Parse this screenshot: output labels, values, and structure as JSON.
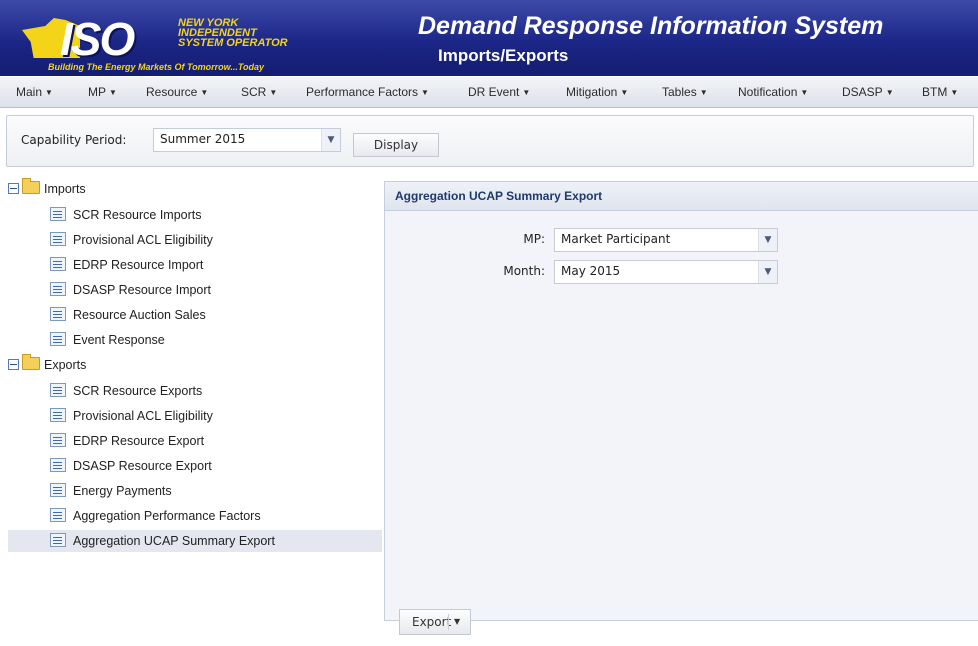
{
  "header": {
    "logo_text": "ISO",
    "logo_org_line1": "NEW YORK",
    "logo_org_line2": "INDEPENDENT",
    "logo_org_line3": "SYSTEM OPERATOR",
    "logo_tagline": "Building The Energy Markets Of Tomorrow...Today",
    "app_title": "Demand Response Information System",
    "page_subtitle": "Imports/Exports"
  },
  "menu": {
    "items": [
      "Main",
      "MP",
      "Resource",
      "SCR",
      "Performance Factors",
      "DR Event",
      "Mitigation",
      "Tables",
      "Notification",
      "DSASP",
      "BTM"
    ]
  },
  "capability": {
    "label": "Capability Period:",
    "selected": "Summer 2015",
    "display_label": "Display"
  },
  "tree": {
    "imports": {
      "label": "Imports",
      "items": [
        "SCR Resource Imports",
        "Provisional ACL Eligibility",
        "EDRP Resource Import",
        "DSASP Resource Import",
        "Resource Auction Sales",
        "Event Response"
      ]
    },
    "exports": {
      "label": "Exports",
      "items": [
        "SCR Resource Exports",
        "Provisional ACL Eligibility",
        "EDRP Resource Export",
        "DSASP Resource Export",
        "Energy Payments",
        "Aggregation Performance Factors",
        "Aggregation UCAP Summary Export"
      ]
    },
    "selected": "Aggregation UCAP Summary Export"
  },
  "panel": {
    "title": "Aggregation UCAP Summary Export",
    "mp_label": "MP:",
    "mp_value": "Market Participant",
    "month_label": "Month:",
    "month_value": "May 2015",
    "export_label": "Export"
  }
}
